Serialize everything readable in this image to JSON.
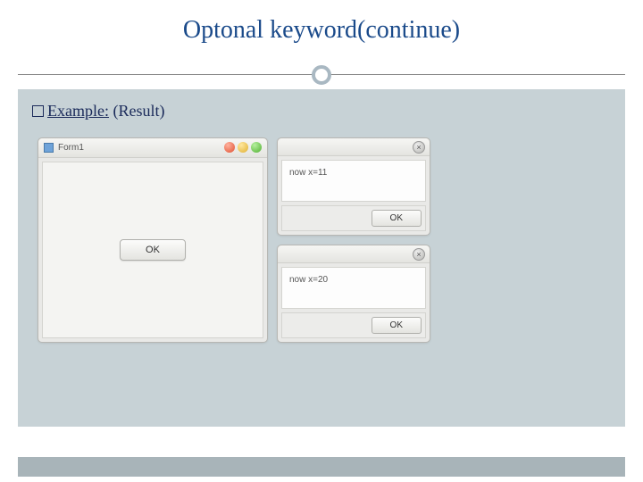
{
  "title": "Optonal keyword(continue)",
  "example_label": "Example:",
  "example_suffix": " (Result)",
  "form1": {
    "title": "Form1",
    "button": "OK"
  },
  "dialogs": [
    {
      "message": "now x=11",
      "button": "OK"
    },
    {
      "message": "now x=20",
      "button": "OK"
    }
  ]
}
